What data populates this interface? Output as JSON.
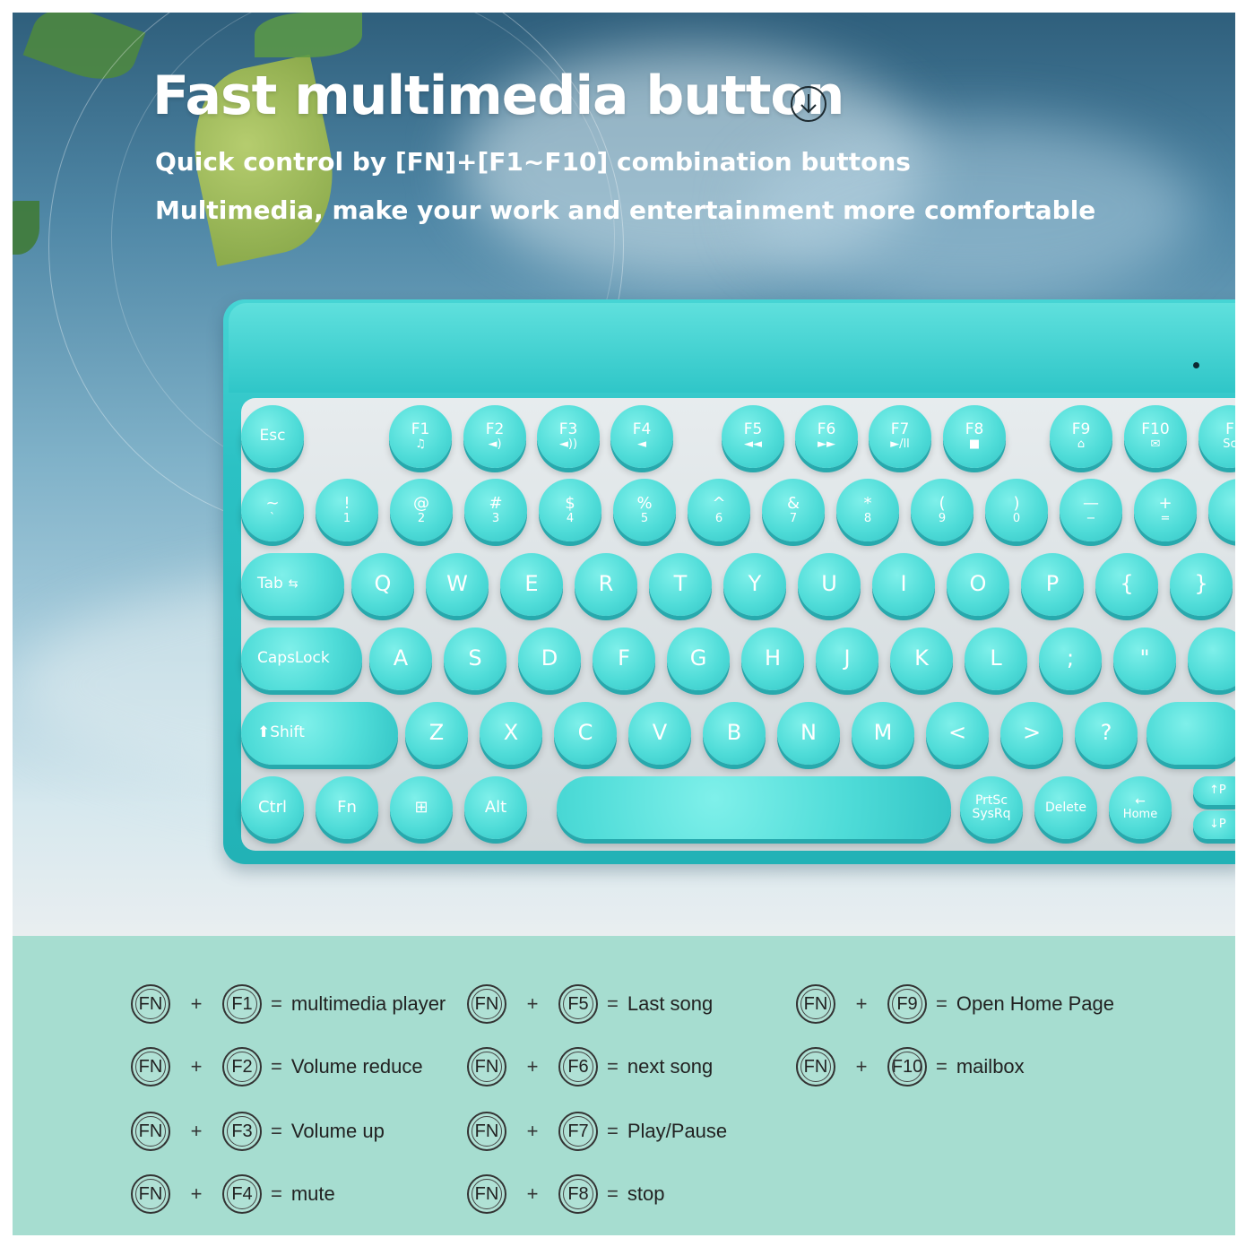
{
  "header": {
    "title": "Fast multimedia button",
    "subtitle1": "Quick control by [FN]+[F1~F10] combination buttons",
    "subtitle2": "Multimedia, make your work and entertainment more comfortable"
  },
  "icons": {
    "title_icon": "down-arrow-circle-icon"
  },
  "colors": {
    "keyboard": "#3fd0d0",
    "legend_bg": "#a6ddd0",
    "text": "#ffffff"
  },
  "keyboard": {
    "row0": [
      {
        "t": "Esc",
        "s": ""
      },
      {
        "t": "F1",
        "s": "♫"
      },
      {
        "t": "F2",
        "s": "◄)"
      },
      {
        "t": "F3",
        "s": "◄))"
      },
      {
        "t": "F4",
        "s": "◄"
      },
      {
        "t": "F5",
        "s": "◄◄"
      },
      {
        "t": "F6",
        "s": "►►"
      },
      {
        "t": "F7",
        "s": "►/ll"
      },
      {
        "t": "F8",
        "s": "■"
      },
      {
        "t": "F9",
        "s": "⌂"
      },
      {
        "t": "F10",
        "s": "✉"
      },
      {
        "t": "F",
        "s": "Sc"
      }
    ],
    "row1": [
      {
        "t": "~",
        "s": "`"
      },
      {
        "t": "!",
        "s": "1"
      },
      {
        "t": "@",
        "s": "2"
      },
      {
        "t": "#",
        "s": "3"
      },
      {
        "t": "$",
        "s": "4"
      },
      {
        "t": "%",
        "s": "5"
      },
      {
        "t": "^",
        "s": "6"
      },
      {
        "t": "&",
        "s": "7"
      },
      {
        "t": "*",
        "s": "8"
      },
      {
        "t": "(",
        "s": "9"
      },
      {
        "t": ")",
        "s": "0"
      },
      {
        "t": "—",
        "s": "−"
      },
      {
        "t": "+",
        "s": "="
      },
      {
        "t": "",
        "s": ""
      }
    ],
    "row2_tab": "Tab",
    "row2": [
      "Q",
      "W",
      "E",
      "R",
      "T",
      "Y",
      "U",
      "I",
      "O",
      "P",
      "{",
      "}"
    ],
    "row3_caps": "CapsLock",
    "row3": [
      "A",
      "S",
      "D",
      "F",
      "G",
      "H",
      "J",
      "K",
      "L",
      ";",
      "\"",
      ""
    ],
    "row4_shift": "Shift",
    "row4": [
      "Z",
      "X",
      "C",
      "V",
      "B",
      "N",
      "M",
      "<",
      ">",
      "?"
    ],
    "row5": [
      {
        "t": "Ctrl"
      },
      {
        "t": "Fn"
      },
      {
        "t": "⊞"
      },
      {
        "t": "Alt"
      }
    ],
    "prtsc": "PrtSc SysRq",
    "delete": "Delete",
    "home": "Home",
    "pgup": "↑P",
    "pgdn": "↓P"
  },
  "legend": [
    {
      "fn": "FN",
      "plus": "+",
      "key": "F1",
      "eq": "=",
      "desc": "multimedia player"
    },
    {
      "fn": "FN",
      "plus": "+",
      "key": "F2",
      "eq": "=",
      "desc": "Volume reduce"
    },
    {
      "fn": "FN",
      "plus": "+",
      "key": "F3",
      "eq": "=",
      "desc": "Volume up"
    },
    {
      "fn": "FN",
      "plus": "+",
      "key": "F4",
      "eq": "=",
      "desc": "mute"
    },
    {
      "fn": "FN",
      "plus": "+",
      "key": "F5",
      "eq": "=",
      "desc": "Last song"
    },
    {
      "fn": "FN",
      "plus": "+",
      "key": "F6",
      "eq": "=",
      "desc": "next song"
    },
    {
      "fn": "FN",
      "plus": "+",
      "key": "F7",
      "eq": "=",
      "desc": "Play/Pause"
    },
    {
      "fn": "FN",
      "plus": "+",
      "key": "F8",
      "eq": "=",
      "desc": "stop"
    },
    {
      "fn": "FN",
      "plus": "+",
      "key": "F9",
      "eq": "=",
      "desc": "Open Home Page"
    },
    {
      "fn": "FN",
      "plus": "+",
      "key": "F10",
      "eq": "=",
      "desc": "mailbox"
    }
  ]
}
